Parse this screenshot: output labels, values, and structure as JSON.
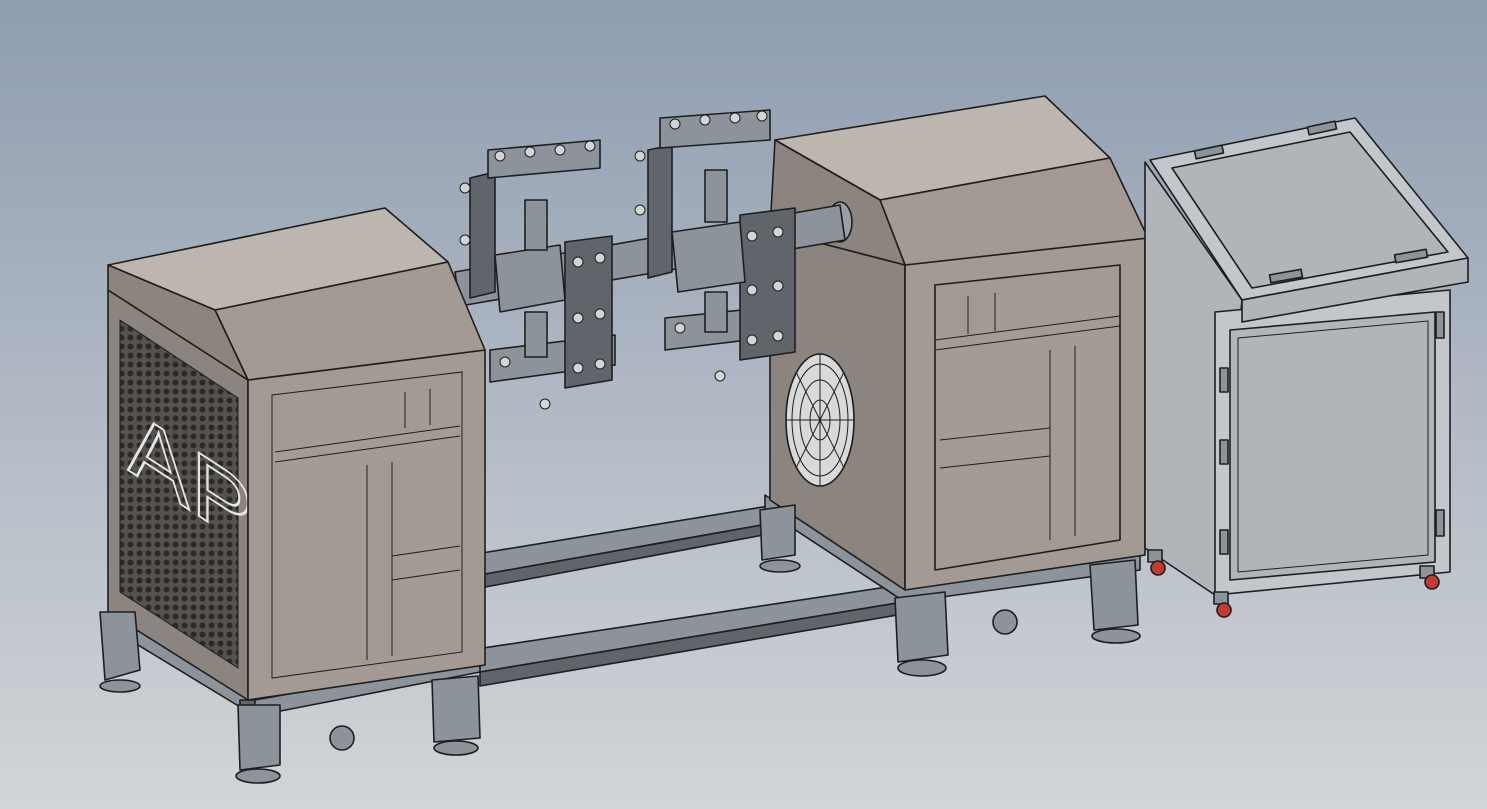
{
  "scene": {
    "logo_text": "APT",
    "colors": {
      "background_top": "#8f9db0",
      "background_bottom": "#d2d5d8",
      "housing": "#a29a93",
      "housing_dark": "#8c847e",
      "housing_light": "#bdb6ae",
      "frame_steel": "#8d939a",
      "frame_steel_dark": "#5f656b",
      "cabinet": "#c3c7cb",
      "cabinet_door": "#b1b5ba",
      "edge": "#1e1e1e",
      "logo_blue": "#3a4fa8",
      "caster_red": "#c43a2f"
    }
  }
}
